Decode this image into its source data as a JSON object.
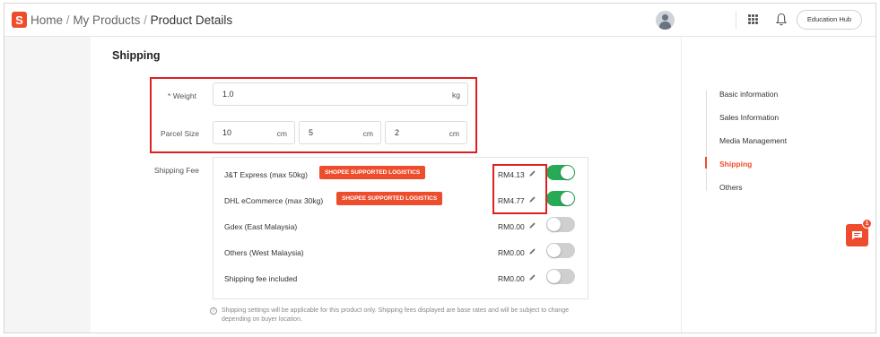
{
  "header": {
    "logo": "S",
    "breadcrumbs": [
      "Home",
      "My Products",
      "Product Details"
    ],
    "separator": "/",
    "education_hub": "Education Hub"
  },
  "section": {
    "title": "Shipping"
  },
  "weight": {
    "required_mark": "*",
    "label": "Weight",
    "value": "1.0",
    "unit": "kg"
  },
  "parcel": {
    "label": "Parcel Size",
    "dims": [
      {
        "value": "10",
        "unit": "cm"
      },
      {
        "value": "5",
        "unit": "cm"
      },
      {
        "value": "2",
        "unit": "cm"
      }
    ]
  },
  "shipping_fee": {
    "label": "Shipping Fee",
    "rows": [
      {
        "name": "J&T Express  (max 50kg)",
        "badge": "SHOPEE SUPPORTED LOGISTICS",
        "price": "RM4.13",
        "enabled": true
      },
      {
        "name": "DHL eCommerce  (max 30kg)",
        "badge": "SHOPEE SUPPORTED LOGISTICS",
        "price": "RM4.77",
        "enabled": true
      },
      {
        "name": "Gdex (East Malaysia)",
        "badge": "",
        "price": "RM0.00",
        "enabled": false
      },
      {
        "name": "Others (West Malaysia)",
        "badge": "",
        "price": "RM0.00",
        "enabled": false
      },
      {
        "name": "Shipping fee included",
        "badge": "",
        "price": "RM0.00",
        "enabled": false
      }
    ],
    "note": "Shipping settings will be applicable for this product only. Shipping fees displayed are base rates and will be subject to change depending on buyer location."
  },
  "side_nav": {
    "items": [
      "Basic information",
      "Sales Information",
      "Media Management",
      "Shipping",
      "Others"
    ],
    "active": "Shipping"
  },
  "chat": {
    "count": "1"
  },
  "colors": {
    "brand": "#ee4d2d",
    "toggle_on": "#26aa56",
    "toggle_off": "#cfcfcf",
    "highlight_box": "#e02020"
  }
}
